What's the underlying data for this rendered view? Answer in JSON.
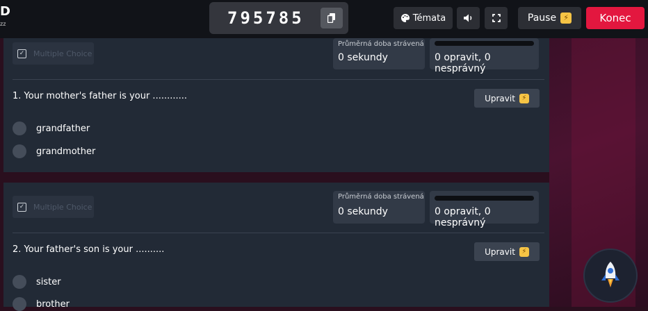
{
  "header": {
    "logo": "D",
    "logo_sub": "zz",
    "game_code": "795785",
    "themes_label": "Témata",
    "pause_label": "Pause",
    "end_label": "Konec"
  },
  "questions": [
    {
      "type_label": "Multiple Choice",
      "avg_time_title": "Průměrná doba strávená",
      "avg_time_value": "0 sekundy",
      "result_value": "0 opravit, 0 nesprávný",
      "text": "1. Your mother's father is your ............",
      "edit_label": "Upravit",
      "options": [
        "grandfather",
        "grandmother"
      ]
    },
    {
      "type_label": "Multiple Choice",
      "avg_time_title": "Průměrná doba strávená",
      "avg_time_value": "0 sekundy",
      "result_value": "0 opravit, 0 nesprávný",
      "text": "2. Your father's son is your ..........",
      "edit_label": "Upravit",
      "options": [
        "sister",
        "brother"
      ]
    }
  ],
  "icons": [
    "copy-icon",
    "palette-icon",
    "volume-icon",
    "fullscreen-icon",
    "bolt-icon",
    "checkbox-icon",
    "rocket-icon"
  ],
  "colors": {
    "end_button": "#e3173f",
    "bolt": "#f6c445",
    "card": "#222a36"
  }
}
